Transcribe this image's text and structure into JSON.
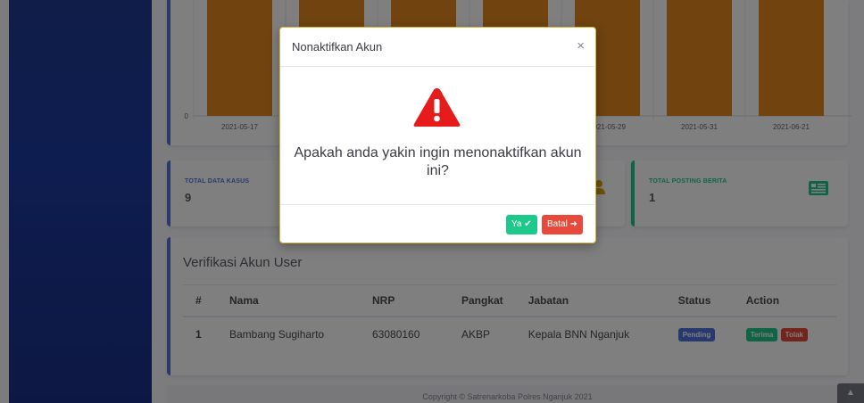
{
  "chart_data": {
    "type": "bar",
    "categories": [
      "2021-05-17",
      "",
      "",
      "",
      "2021-05-29",
      "2021-05-31",
      "2021-06-21"
    ],
    "visible_tick_labels": [
      "2021-05-17",
      "21-05-29",
      "2021-05-31",
      "2021-06-21"
    ],
    "y_zero_label": "0",
    "bar_color": "#e0861f"
  },
  "stats": {
    "total_kasus_label": "TOTAL DATA KASUS",
    "total_kasus_value": "9",
    "total_berita_label": "TOTAL POSTING BERITA",
    "total_berita_value": "1"
  },
  "verification": {
    "title": "Verifikasi Akun User",
    "headers": [
      "#",
      "Nama",
      "NRP",
      "Pangkat",
      "Jabatan",
      "Status",
      "Action"
    ],
    "rows": [
      {
        "no": "1",
        "nama": "Bambang Sugiharto",
        "nrp": "63080160",
        "pangkat": "AKBP",
        "jabatan": "Kepala BNN Nganjuk",
        "status": "Pending",
        "terima": "Terima",
        "tolak": "Tolak"
      }
    ]
  },
  "footer": {
    "copyright": "Copyright © Satrenarkoba Polres Nganjuk 2021"
  },
  "modal": {
    "title": "Nonaktifkan Akun",
    "close_glyph": "×",
    "message": "Apakah anda yakin ingin menonaktifkan akun ini?",
    "yes_label": "Ya",
    "cancel_label": "Batal"
  },
  "colors": {
    "primary": "#4e73df",
    "success": "#1cc88a",
    "danger": "#e74a3b",
    "warning": "#f6c23e"
  }
}
